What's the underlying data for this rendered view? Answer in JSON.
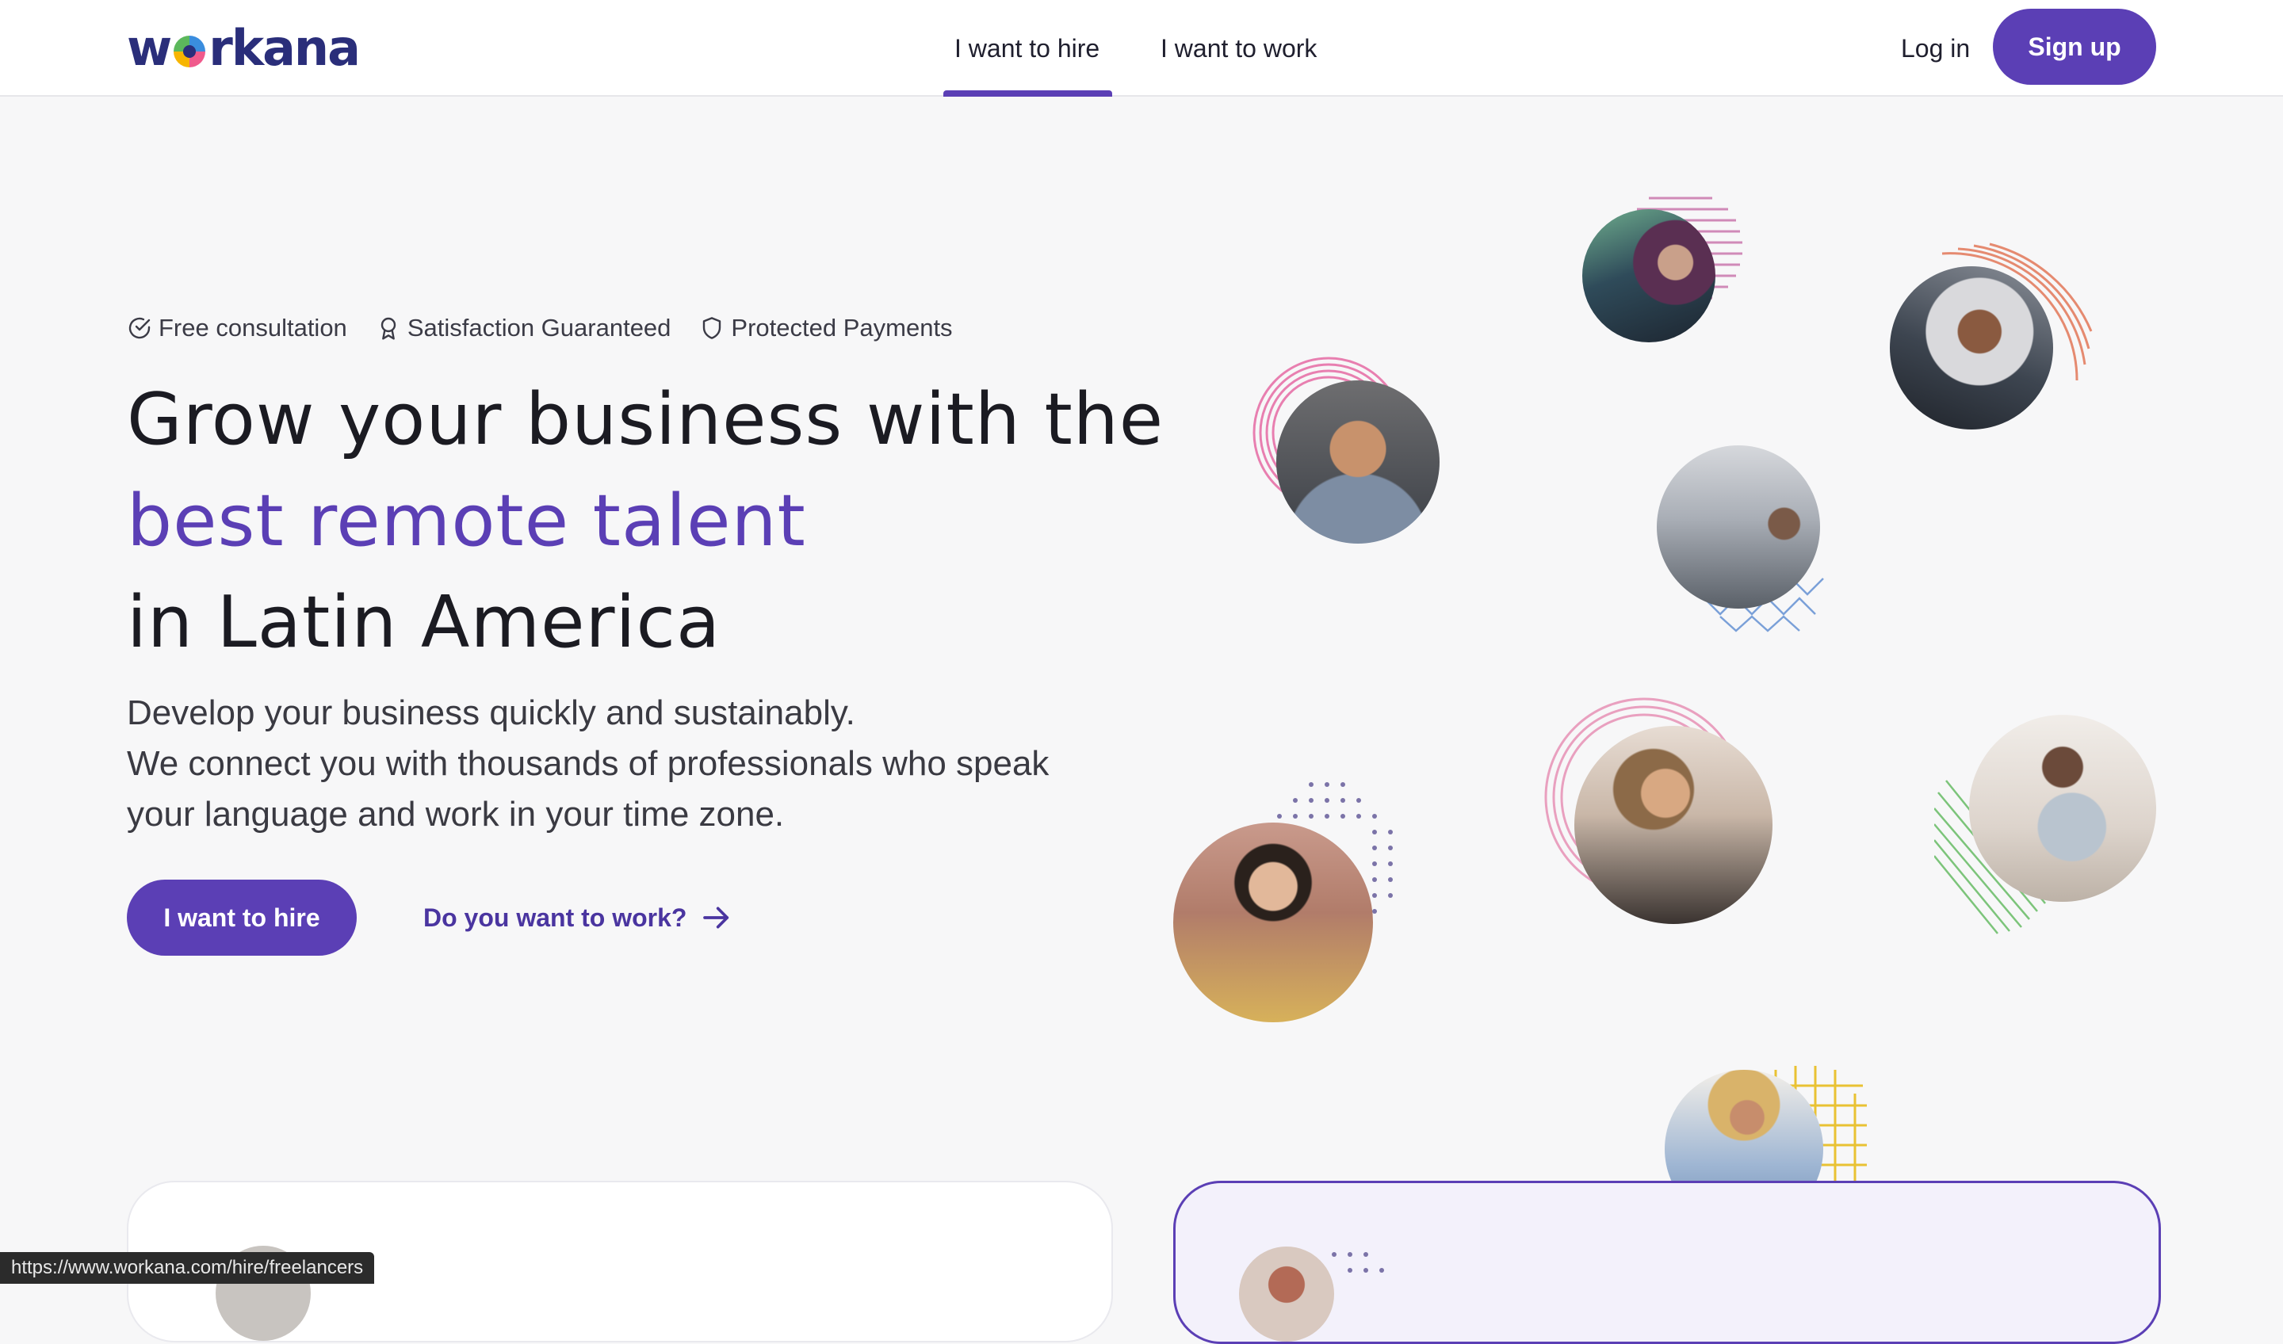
{
  "header": {
    "logo_text": "workana",
    "tabs": [
      {
        "label": "I want to hire",
        "active": true
      },
      {
        "label": "I want to work",
        "active": false
      }
    ],
    "login_label": "Log in",
    "signup_label": "Sign up"
  },
  "hero": {
    "badges": [
      {
        "icon": "check-circle-icon",
        "label": "Free consultation"
      },
      {
        "icon": "award-ribbon-icon",
        "label": "Satisfaction Guaranteed"
      },
      {
        "icon": "shield-icon",
        "label": "Protected Payments"
      }
    ],
    "headline_line1": "Grow your business with the",
    "headline_accent": "best remote talent",
    "headline_line3": "in Latin America",
    "subtitle_line1": "Develop your business quickly and sustainably.",
    "subtitle_line2": "We connect you with thousands of professionals who speak",
    "subtitle_line3": "your language and work in your time zone.",
    "cta_hire_label": "I want to hire",
    "cta_work_label": "Do you want to work?",
    "cta_work_icon": "arrow-right-icon"
  },
  "status_bar": {
    "url": "https://www.workana.com/hire/freelancers"
  },
  "colors": {
    "brand_purple": "#5b3fb5",
    "logo_navy": "#2a2e7a",
    "background": "#f7f7f8"
  }
}
